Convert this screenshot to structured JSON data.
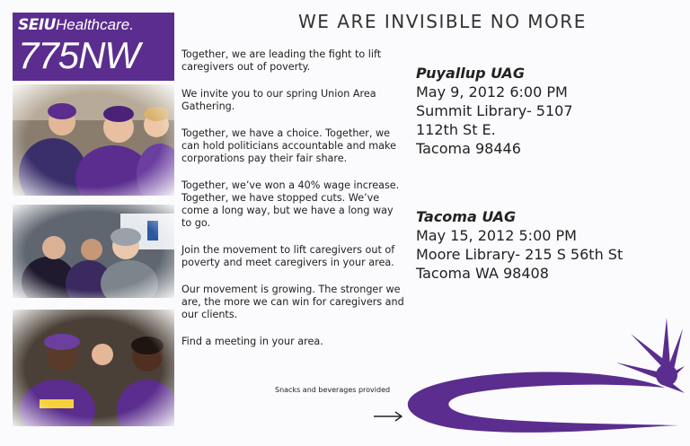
{
  "logo": {
    "brand_a": "SEIU",
    "brand_b": "Healthcare.",
    "local": "775NW"
  },
  "headline": "WE ARE INVISIBLE NO MORE",
  "body": [
    "Together, we are leading the fight to lift caregivers out of poverty.",
    "We invite you to our spring Union Area Gathering.",
    "Together, we have a choice. Together, we can hold politicians accountable and make corporations pay their fair share.",
    "Together, we’ve won a 40% wage increase. Together, we have stopped cuts. We’ve come a long way, but we have a long way to go.",
    "Join the movement to lift caregivers out of poverty and meet caregivers in your area.",
    "Our movement is growing. The stronger we are, the more we can win for caregivers and our clients.",
    "Find a meeting in your area."
  ],
  "events": [
    {
      "name": "Puyallup UAG",
      "lines": [
        "May 9, 2012 6:00 PM",
        "Summit Library- 5107",
        "112th St E.",
        "Tacoma 98446"
      ]
    },
    {
      "name": "Tacoma UAG",
      "lines": [
        "May 15, 2012 5:00 PM",
        "Moore Library- 215 S 56th St",
        "Tacoma WA 98408"
      ]
    }
  ],
  "footer": {
    "snacks": "Snacks and beverages provided"
  },
  "colors": {
    "brand_purple": "#5b2d8e"
  }
}
